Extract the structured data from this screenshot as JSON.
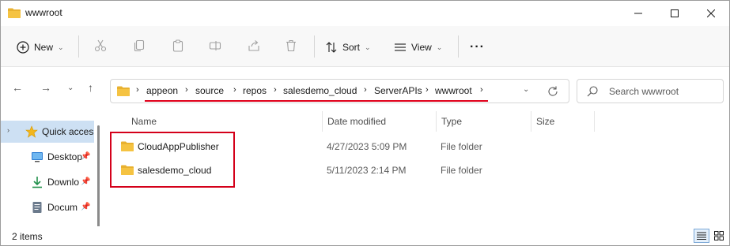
{
  "window": {
    "title": "wwwroot"
  },
  "toolbar": {
    "new_label": "New",
    "sort_label": "Sort",
    "view_label": "View",
    "more_label": "···"
  },
  "address": {
    "crumbs": [
      "appeon",
      "source",
      "repos",
      "salesdemo_cloud",
      "ServerAPIs",
      "wwwroot"
    ]
  },
  "search": {
    "placeholder": "Search wwwroot"
  },
  "sidebar": {
    "items": [
      {
        "label": "Quick acces",
        "icon": "star-icon",
        "selected": true
      },
      {
        "label": "Desktop",
        "icon": "desktop-icon",
        "pinned": true
      },
      {
        "label": "Downlo",
        "icon": "download-icon",
        "pinned": true
      },
      {
        "label": "Docum",
        "icon": "document-icon",
        "pinned": true
      }
    ]
  },
  "columns": {
    "name": "Name",
    "date": "Date modified",
    "type": "Type",
    "size": "Size"
  },
  "files": [
    {
      "name": "CloudAppPublisher",
      "date": "4/27/2023 5:09 PM",
      "type": "File folder"
    },
    {
      "name": "salesdemo_cloud",
      "date": "5/11/2023 2:14 PM",
      "type": "File folder"
    }
  ],
  "status": {
    "items_count": "2 items"
  },
  "colors": {
    "folder": "#f5c342",
    "highlight": "#d4001a",
    "selected": "#cde0f3"
  }
}
